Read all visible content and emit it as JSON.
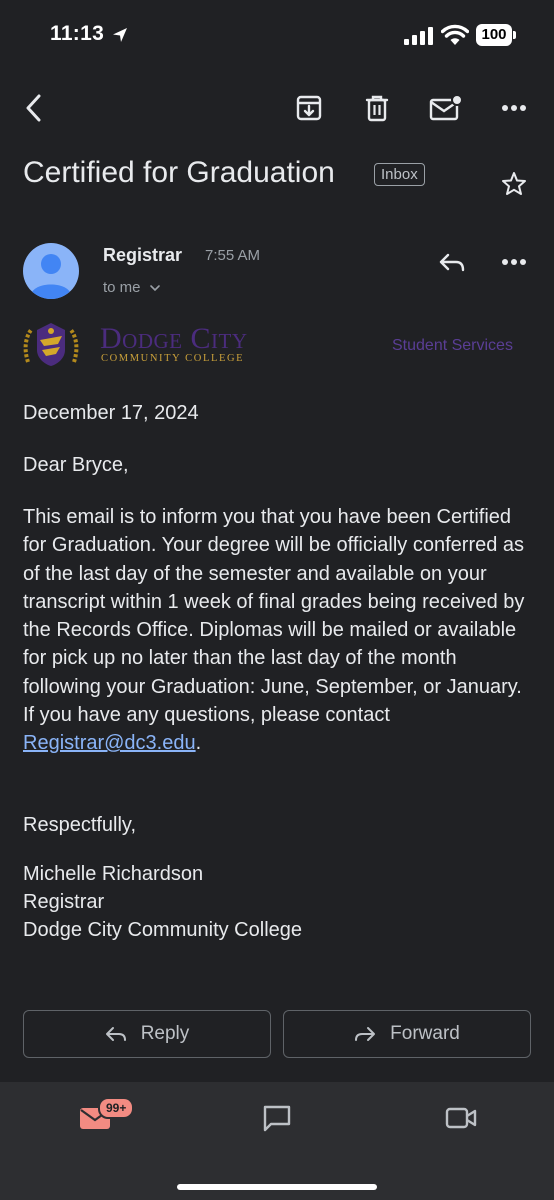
{
  "status_bar": {
    "time": "11:13",
    "battery": "100"
  },
  "email": {
    "subject": "Certified for Graduation",
    "label": "Inbox",
    "sender": "Registrar",
    "time": "7:55 AM",
    "recipient": "to me"
  },
  "logo": {
    "name": "Dodge City",
    "subtitle": "COMMUNITY COLLEGE",
    "department": "Student Services"
  },
  "body": {
    "date": "December 17, 2024",
    "greeting": "Dear Bryce,",
    "paragraph": "This email is to inform you that you have been Certified for Graduation. Your degree will be officially conferred as of the last day of the semester and available on your transcript within 1 week of final grades being received by the Records Office. Diplomas will be mailed or available for pick up no later than the last day of the month following your Graduation: June, September, or January. If you have any questions, please contact ",
    "email_link": "Registrar@dc3.edu",
    "paragraph_end": ".",
    "closing": "Respectfully,",
    "signature_name": "Michelle Richardson",
    "signature_title": "Registrar",
    "signature_org": "Dodge City Community College"
  },
  "actions": {
    "reply": "Reply",
    "forward": "Forward"
  },
  "bottom_nav": {
    "mail_badge": "99+"
  },
  "icons": [
    "back-icon",
    "archive-icon",
    "trash-icon",
    "mark-unread-icon",
    "more-icon",
    "star-icon",
    "reply-icon",
    "mail-icon",
    "chat-icon",
    "meet-icon"
  ],
  "colors": {
    "background": "#202124",
    "link": "#8ab4f8",
    "avatar": "#8ab4f8",
    "brand_purple": "#4b2c7e",
    "brand_gold": "#c9a03a",
    "badge": "#f28b82"
  }
}
